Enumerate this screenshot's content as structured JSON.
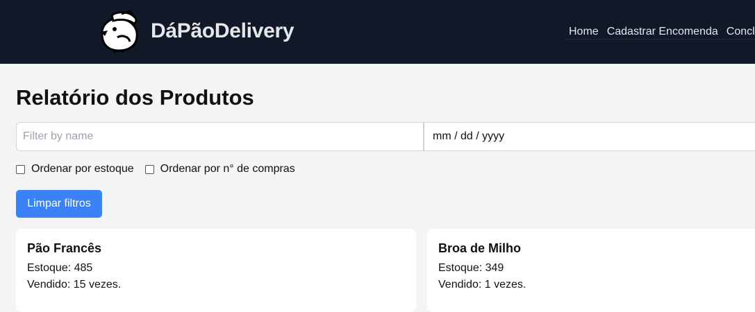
{
  "brand": {
    "name": "DáPãoDelivery",
    "logo_icon": "bread-mascot-icon"
  },
  "nav": {
    "items": [
      {
        "label": "Home"
      },
      {
        "label": "Cadastrar Encomenda"
      },
      {
        "label": "Conclu"
      }
    ]
  },
  "page": {
    "title": "Relatório dos Produtos"
  },
  "filters": {
    "name_placeholder": "Filter by name",
    "date_placeholder": "mm / dd / yyyy",
    "sort_stock_label": "Ordenar por estoque",
    "sort_stock_checked": false,
    "sort_purchases_label": "Ordenar por n° de compras",
    "sort_purchases_checked": false,
    "clear_label": "Limpar filtros"
  },
  "products": [
    {
      "name": "Pão Francês",
      "stock": "Estoque: 485",
      "sold": "Vendido: 15 vezes."
    },
    {
      "name": "Broa de Milho",
      "stock": "Estoque: 349",
      "sold": "Vendido: 1 vezes."
    }
  ],
  "colors": {
    "navbar": "#111827",
    "accent": "#3b82f6",
    "background": "#f3f4f6"
  }
}
